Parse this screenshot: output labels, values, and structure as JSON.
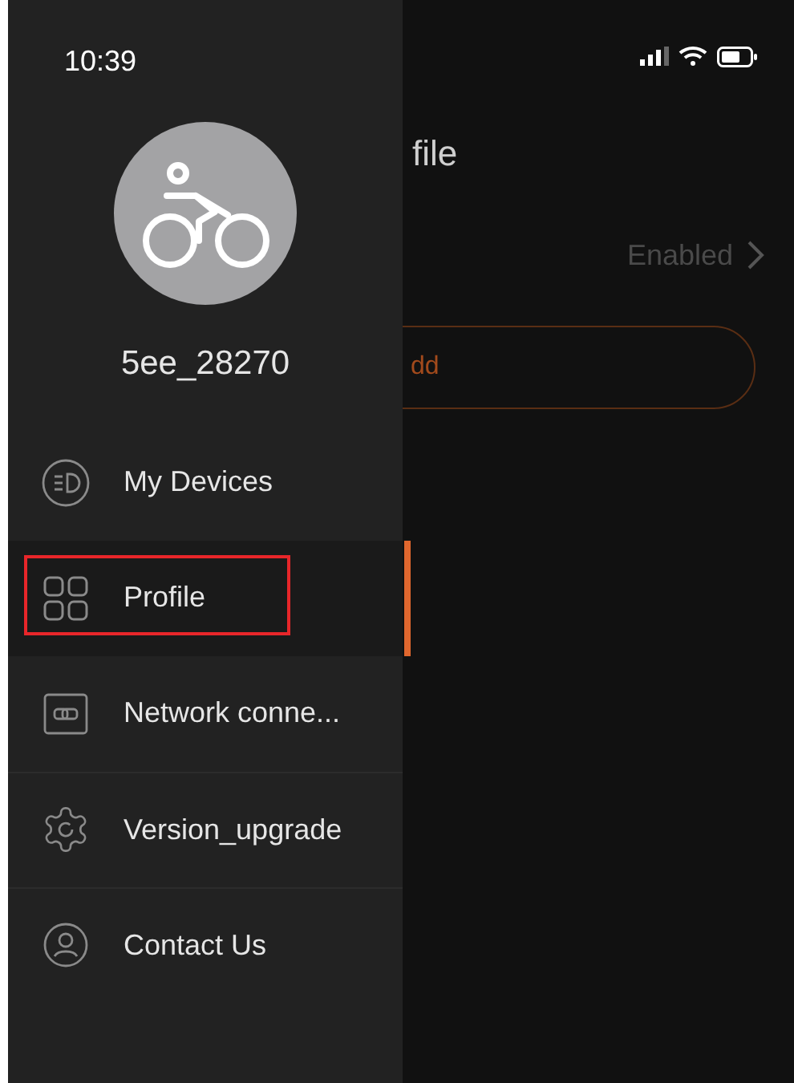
{
  "status_bar": {
    "time": "10:39"
  },
  "drawer": {
    "username": "5ee_28270",
    "items": [
      {
        "kind": "devices",
        "label": "My Devices",
        "selected": false
      },
      {
        "kind": "profile",
        "label": "Profile",
        "selected": true
      },
      {
        "kind": "network",
        "label": "Network conne...",
        "selected": false
      },
      {
        "kind": "upgrade",
        "label": "Version_upgrade",
        "selected": false
      },
      {
        "kind": "contact",
        "label": "Contact Us",
        "selected": false
      }
    ]
  },
  "background_page": {
    "title": "file",
    "setting_value": "Enabled",
    "button": "dd"
  }
}
